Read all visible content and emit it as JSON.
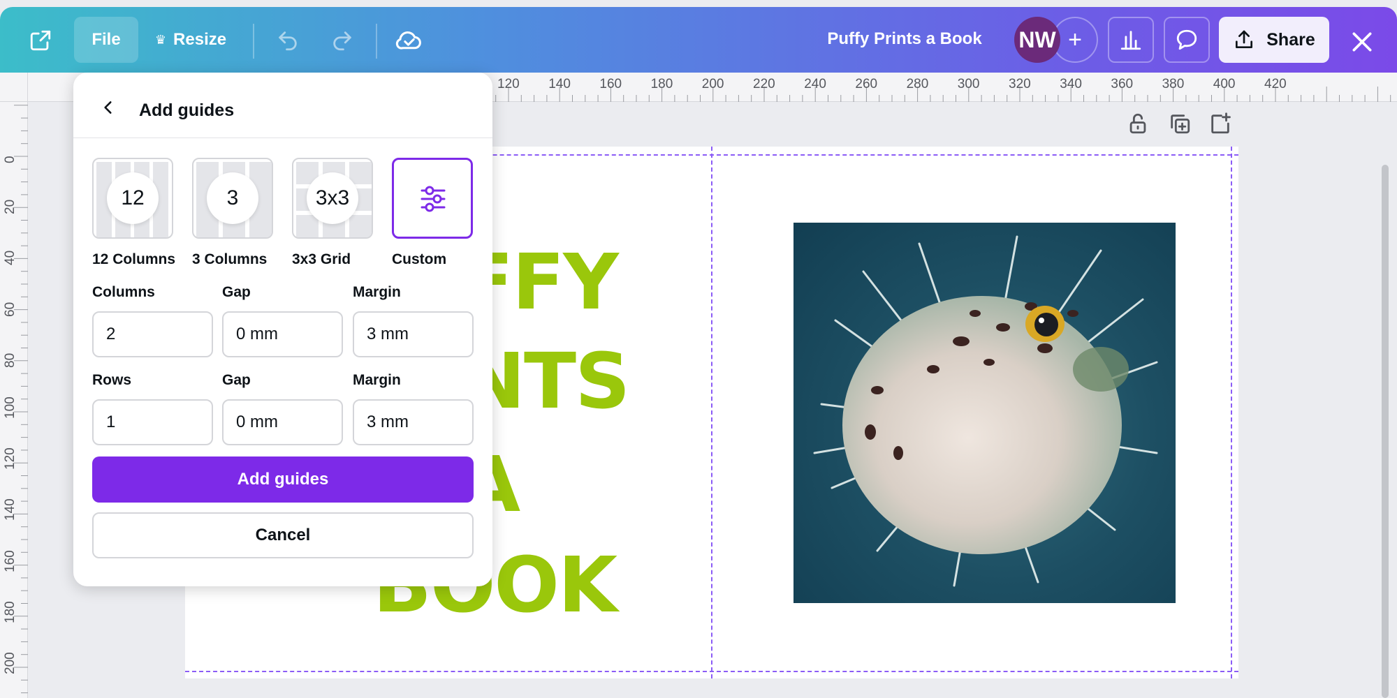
{
  "topbar": {
    "file_label": "File",
    "resize_label": "Resize",
    "doc_title": "Puffy Prints a Book",
    "avatar_initials": "NW",
    "plus_label": "+",
    "share_label": "Share"
  },
  "ruler": {
    "top_labels": [
      "120",
      "140",
      "160",
      "180",
      "200",
      "220",
      "240",
      "260",
      "280",
      "300",
      "320",
      "340",
      "360",
      "380",
      "400",
      "420"
    ],
    "left_labels": [
      "0",
      "20",
      "40",
      "60",
      "80",
      "100",
      "120",
      "140",
      "160",
      "180",
      "200"
    ]
  },
  "canvas": {
    "words": [
      "FFY",
      "NTS",
      "A",
      "BOOK"
    ],
    "accent_color": "#9ac70b"
  },
  "panel": {
    "title": "Add guides",
    "presets": [
      {
        "badge": "12",
        "label": "12 Columns"
      },
      {
        "badge": "3",
        "label": "3 Columns"
      },
      {
        "badge": "3x3",
        "label": "3x3 Grid"
      },
      {
        "badge": "",
        "label": "Custom"
      }
    ],
    "columns_label": "Columns",
    "columns_value": "2",
    "col_gap_label": "Gap",
    "col_gap_value": "0 mm",
    "col_margin_label": "Margin",
    "col_margin_value": "3 mm",
    "rows_label": "Rows",
    "rows_value": "1",
    "row_gap_label": "Gap",
    "row_gap_value": "0 mm",
    "row_margin_label": "Margin",
    "row_margin_value": "3 mm",
    "add_button": "Add guides",
    "cancel_button": "Cancel",
    "brand_color": "#7d2ae8"
  }
}
